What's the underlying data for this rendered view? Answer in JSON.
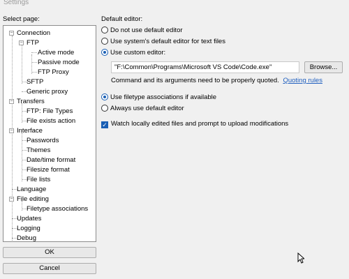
{
  "window": {
    "title": "Settings"
  },
  "sidebar": {
    "label": "Select page:",
    "tree": {
      "connection": "Connection",
      "ftp": "FTP",
      "active_mode": "Active mode",
      "passive_mode": "Passive mode",
      "ftp_proxy": "FTP Proxy",
      "sftp": "SFTP",
      "generic_proxy": "Generic proxy",
      "transfers": "Transfers",
      "ftp_file_types": "FTP: File Types",
      "file_exists_action": "File exists action",
      "interface": "Interface",
      "passwords": "Passwords",
      "themes": "Themes",
      "datetime_format": "Date/time format",
      "filesize_format": "Filesize format",
      "file_lists": "File lists",
      "language": "Language",
      "file_editing": "File editing",
      "filetype_associations": "Filetype associations",
      "updates": "Updates",
      "logging": "Logging",
      "debug": "Debug"
    },
    "ok_label": "OK",
    "cancel_label": "Cancel"
  },
  "main": {
    "default_editor_label": "Default editor:",
    "opt_no_default": "Do not use default editor",
    "opt_system_default": "Use system's default editor for text files",
    "opt_custom": "Use custom editor:",
    "editor_path": "\"F:\\Common\\Programs\\Microsoft VS Code\\Code.exe\"",
    "browse_label": "Browse...",
    "quote_hint": "Command and its arguments need to be properly quoted.",
    "quoting_rules_link": "Quoting rules",
    "opt_filetype_assoc": "Use filetype associations if available",
    "opt_always_default": "Always use default editor",
    "watch_files": "Watch locally edited files and prompt to upload modifications"
  },
  "colors": {
    "accent": "#1a5fb4",
    "link": "#1f5fbf"
  }
}
